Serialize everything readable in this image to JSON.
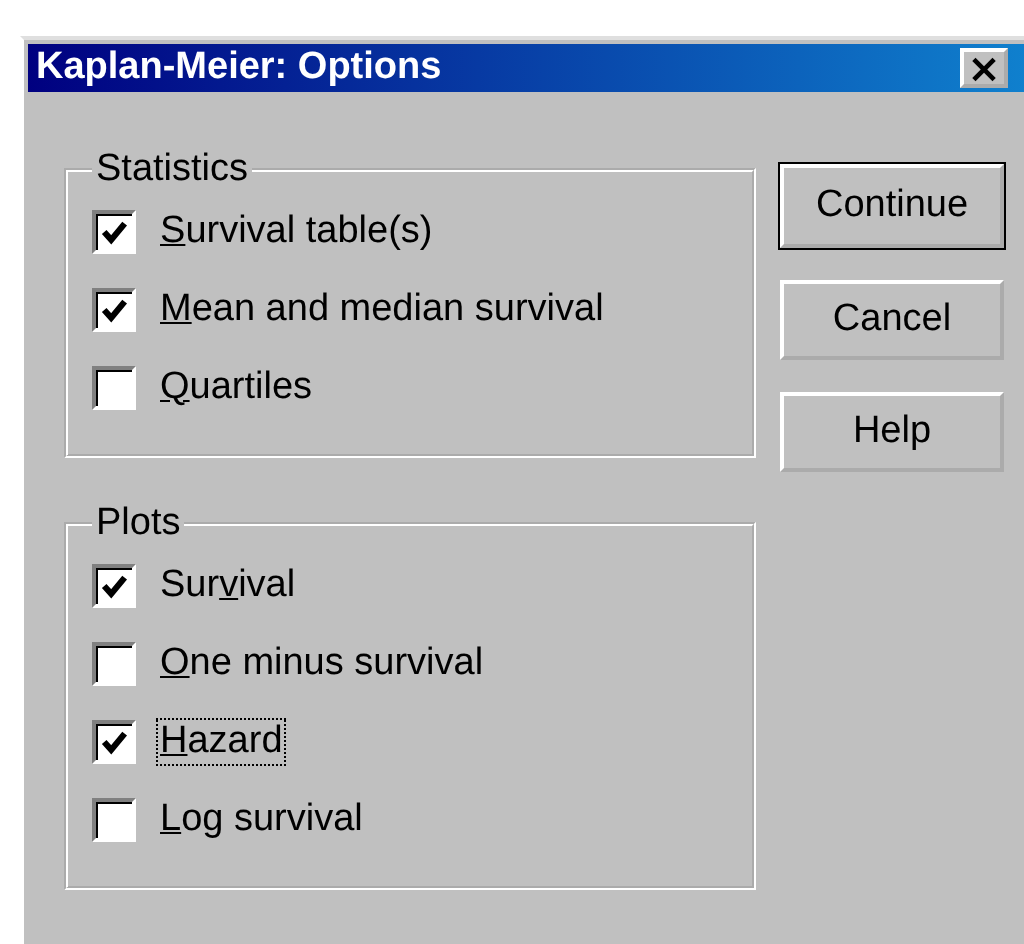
{
  "window": {
    "title": "Kaplan-Meier: Options",
    "close": "×"
  },
  "groups": [
    {
      "title": "Statistics",
      "options": [
        {
          "key": "S",
          "after": "urvival table(s)",
          "checked": true,
          "focused": false
        },
        {
          "key": "M",
          "after": "ean and median survival",
          "checked": true,
          "focused": false
        },
        {
          "key": "Q",
          "after": "uartiles",
          "checked": false,
          "focused": false
        }
      ]
    },
    {
      "title": "Plots",
      "options": [
        {
          "before": "Sur",
          "key": "v",
          "after": "ival",
          "checked": true,
          "focused": false
        },
        {
          "key": "O",
          "after": "ne minus survival",
          "checked": false,
          "focused": false
        },
        {
          "key": "H",
          "after": "azard",
          "checked": true,
          "focused": true
        },
        {
          "key": "L",
          "after": "og survival",
          "checked": false,
          "focused": false
        }
      ]
    }
  ],
  "buttons": [
    {
      "label": "Continue",
      "default": true
    },
    {
      "label": "Cancel",
      "default": false
    },
    {
      "label": "Help",
      "default": false
    }
  ]
}
